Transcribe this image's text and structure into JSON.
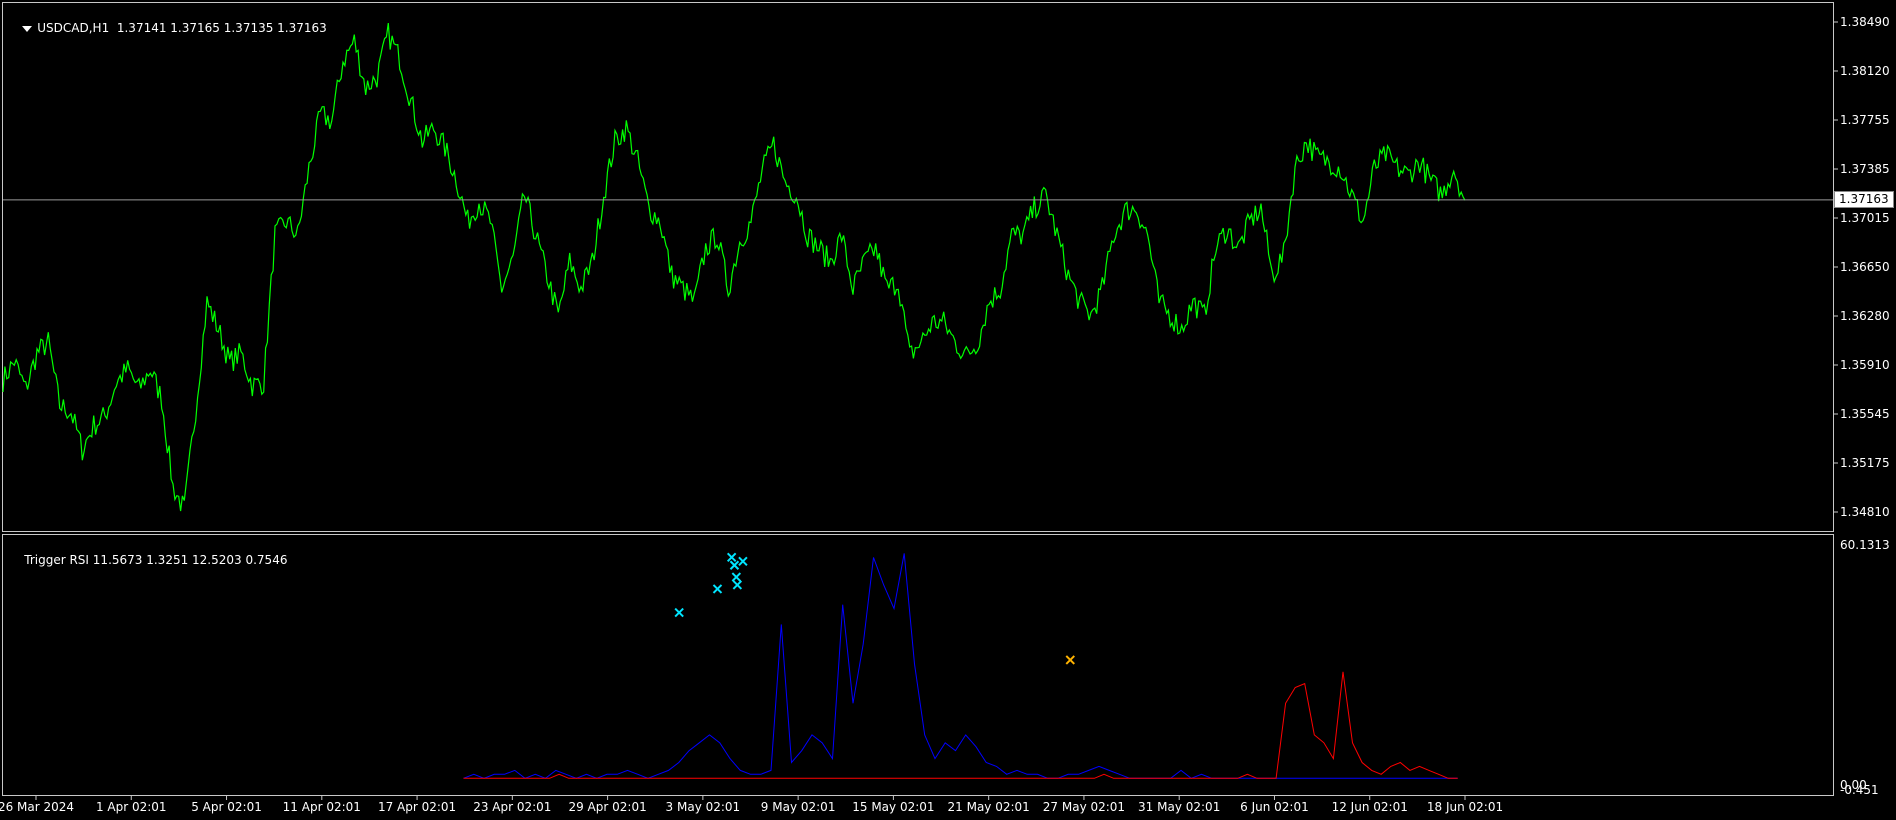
{
  "main": {
    "symbol": "USDCAD,H1",
    "ohlc": "1.37141 1.37165 1.37135 1.37163",
    "current_price": "1.37163",
    "price_line_value": 1.37163,
    "y_ticks": [
      "1.38490",
      "1.38120",
      "1.37755",
      "1.37385",
      "1.37015",
      "1.36650",
      "1.36280",
      "1.35910",
      "1.35545",
      "1.35175",
      "1.34810"
    ],
    "line_color": "#00ff00"
  },
  "indicator": {
    "name": "Trigger RSI",
    "values": "11.5673 1.3251 12.5203 0.7546",
    "y_max_label": "60.1313",
    "y_zero_label": "0.00",
    "y_min_label": "-0.451",
    "colors": {
      "blue": "#0000ff",
      "red": "#ff0000",
      "cyan_marker": "#00e5ff",
      "orange_marker": "#ffb300"
    }
  },
  "x_ticks": [
    "26 Mar 2024",
    "1 Apr 02:01",
    "5 Apr 02:01",
    "11 Apr 02:01",
    "17 Apr 02:01",
    "23 Apr 02:01",
    "29 Apr 02:01",
    "3 May 02:01",
    "9 May 02:01",
    "15 May 02:01",
    "21 May 02:01",
    "27 May 02:01",
    "31 May 02:01",
    "6 Jun 02:01",
    "12 Jun 02:01",
    "18 Jun 02:01"
  ],
  "chart_data": [
    {
      "type": "line",
      "title": "USDCAD,H1",
      "ylim": [
        1.347,
        1.3858
      ],
      "x_range": [
        "26 Mar 2024",
        "18 Jun 02:01"
      ],
      "grid": false,
      "series": [
        {
          "name": "USDCAD",
          "values": [
            1.3582,
            1.3596,
            1.3575,
            1.3602,
            1.361,
            1.3563,
            1.3558,
            1.353,
            1.3548,
            1.3555,
            1.358,
            1.359,
            1.3575,
            1.359,
            1.3568,
            1.3502,
            1.3485,
            1.356,
            1.364,
            1.362,
            1.3595,
            1.3602,
            1.3578,
            1.358,
            1.369,
            1.37,
            1.369,
            1.374,
            1.378,
            1.3775,
            1.382,
            1.3835,
            1.38,
            1.3808,
            1.384,
            1.3822,
            1.379,
            1.376,
            1.377,
            1.3755,
            1.3732,
            1.37,
            1.3715,
            1.37,
            1.365,
            1.3672,
            1.372,
            1.369,
            1.366,
            1.363,
            1.367,
            1.365,
            1.367,
            1.372,
            1.376,
            1.377,
            1.3745,
            1.371,
            1.37,
            1.366,
            1.365,
            1.364,
            1.368,
            1.369,
            1.365,
            1.3685,
            1.37,
            1.3738,
            1.3758,
            1.373,
            1.372,
            1.369,
            1.368,
            1.367,
            1.369,
            1.365,
            1.367,
            1.368,
            1.365,
            1.3655,
            1.36,
            1.361,
            1.3625,
            1.3625,
            1.361,
            1.36,
            1.361,
            1.364,
            1.365,
            1.369,
            1.369,
            1.371,
            1.372,
            1.369,
            1.366,
            1.364,
            1.363,
            1.365,
            1.369,
            1.3708,
            1.371,
            1.369,
            1.364,
            1.363,
            1.362,
            1.364,
            1.363,
            1.368,
            1.3695,
            1.368,
            1.37,
            1.371,
            1.366,
            1.3675,
            1.374,
            1.376,
            1.3748,
            1.3745,
            1.374,
            1.372,
            1.37,
            1.374,
            1.375,
            1.374,
            1.3735,
            1.3745,
            1.373,
            1.372,
            1.374,
            1.3716
          ]
        }
      ],
      "price_line": 1.37163
    },
    {
      "type": "line",
      "title": "Trigger RSI",
      "ylim": [
        -0.451,
        60.1313
      ],
      "x_range": [
        "26 Mar 2024",
        "18 Jun 02:01"
      ],
      "grid": false,
      "series": [
        {
          "color": "#0000ff",
          "x_start_fraction": 0.315,
          "values": [
            1,
            2,
            1,
            2,
            2,
            3,
            1,
            2,
            1,
            3,
            2,
            1,
            2,
            1,
            2,
            2,
            3,
            2,
            1,
            2,
            3,
            5,
            8,
            10,
            12,
            10,
            6,
            3,
            2,
            2,
            3,
            40,
            5,
            8,
            12,
            10,
            6,
            45,
            20,
            35,
            57,
            50,
            44,
            58,
            30,
            12,
            6,
            10,
            8,
            12,
            9,
            5,
            4,
            2,
            3,
            2,
            2,
            1,
            1,
            2,
            2,
            3,
            4,
            3,
            2,
            1,
            1,
            1,
            1,
            1,
            3,
            1,
            2,
            1,
            1,
            1,
            1,
            1,
            1,
            1,
            1,
            1,
            1,
            1,
            1,
            1,
            1,
            1,
            1,
            1,
            1,
            1,
            1,
            1,
            1,
            1,
            1,
            1
          ]
        },
        {
          "color": "#ff0000",
          "x_start_fraction": 0.315,
          "values": [
            1,
            1,
            1,
            1,
            1,
            1,
            1,
            1,
            1,
            1,
            2,
            1,
            1,
            1,
            1,
            1,
            1,
            1,
            1,
            1,
            1,
            1,
            1,
            1,
            1,
            1,
            1,
            1,
            1,
            1,
            1,
            1,
            1,
            1,
            1,
            1,
            1,
            1,
            1,
            1,
            1,
            1,
            1,
            1,
            1,
            1,
            1,
            1,
            1,
            1,
            1,
            1,
            1,
            1,
            1,
            1,
            1,
            1,
            1,
            1,
            1,
            1,
            1,
            1,
            1,
            1,
            1,
            2,
            1,
            1,
            1,
            1,
            1,
            1,
            1,
            1,
            1,
            1,
            1,
            1,
            1,
            1,
            2,
            1,
            1,
            1,
            20,
            24,
            25,
            12,
            10,
            6,
            28,
            10,
            5,
            3,
            2,
            4,
            5,
            3,
            4,
            3,
            2,
            1,
            1
          ]
        }
      ],
      "markers": [
        {
          "color": "#00e5ff",
          "index_fraction": 0.3625,
          "value": 43
        },
        {
          "color": "#00e5ff",
          "index_fraction": 0.3887,
          "value": 49
        },
        {
          "color": "#00e5ff",
          "index_fraction": 0.3984,
          "value": 57
        },
        {
          "color": "#00e5ff",
          "index_fraction": 0.4003,
          "value": 55
        },
        {
          "color": "#00e5ff",
          "index_fraction": 0.4016,
          "value": 52
        },
        {
          "color": "#00e5ff",
          "index_fraction": 0.4023,
          "value": 50
        },
        {
          "color": "#00e5ff",
          "index_fraction": 0.4061,
          "value": 56
        },
        {
          "color": "#ffb300",
          "index_fraction": 0.63,
          "value": 31
        }
      ]
    }
  ]
}
